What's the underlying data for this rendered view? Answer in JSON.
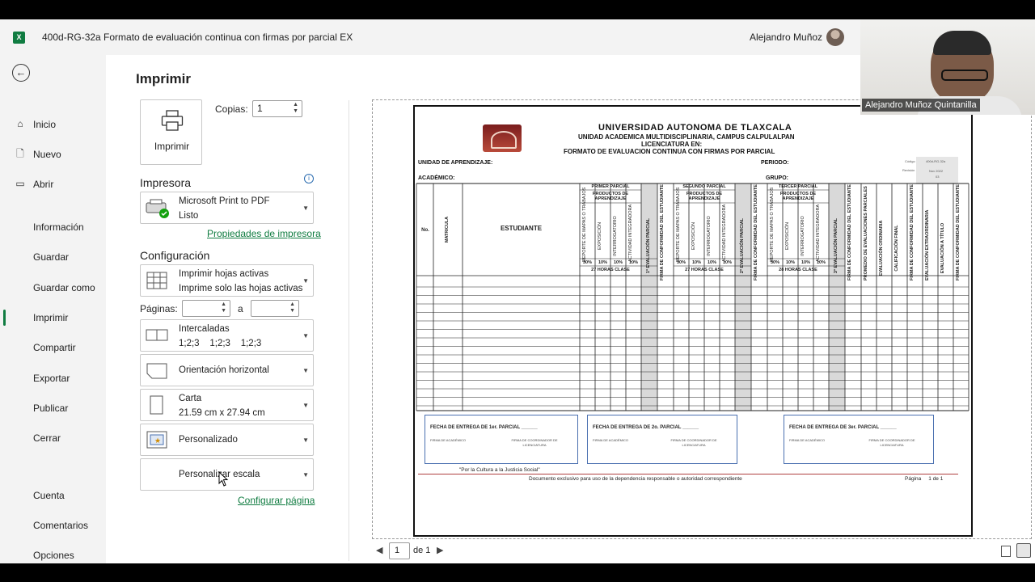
{
  "titlebar": {
    "app_icon": "excel-icon",
    "doc_title": "400d-RG-32a Formato de evaluación continua con firmas por parcial EX",
    "user_name": "Alejandro Muñoz"
  },
  "nav": {
    "items": [
      {
        "label": "Inicio",
        "icon": "home-icon"
      },
      {
        "label": "Nuevo",
        "icon": "new-file-icon"
      },
      {
        "label": "Abrir",
        "icon": "folder-icon"
      },
      {
        "label": "Información"
      },
      {
        "label": "Guardar"
      },
      {
        "label": "Guardar como"
      },
      {
        "label": "Imprimir"
      },
      {
        "label": "Compartir"
      },
      {
        "label": "Exportar"
      },
      {
        "label": "Publicar"
      },
      {
        "label": "Cerrar"
      },
      {
        "label": "Cuenta"
      },
      {
        "label": "Comentarios"
      },
      {
        "label": "Opciones"
      }
    ]
  },
  "print": {
    "title": "Imprimir",
    "button_label": "Imprimir",
    "copies_label": "Copias:",
    "copies_value": "1",
    "printer_heading": "Impresora",
    "printer_name": "Microsoft Print to PDF",
    "printer_status": "Listo",
    "printer_props_link": "Propiedades de impresora",
    "config_heading": "Configuración",
    "scope_main": "Imprimir hojas activas",
    "scope_sub": "Imprime solo las hojas activas",
    "pages_label": "Páginas:",
    "pages_sep": "a",
    "collate_main": "Intercaladas",
    "collate_sub": "1;2;3    1;2;3    1;2;3",
    "orientation": "Orientación horizontal",
    "paper_main": "Carta",
    "paper_sub": "21.59 cm x 27.94 cm",
    "margins": "Personalizado",
    "scaling": "Personalizar escala",
    "page_setup_link": "Configurar página"
  },
  "preview": {
    "university": "UNIVERSIDAD AUTONOMA DE TLAXCALA",
    "unit": "UNIDAD ACADEMICA MULTIDISCIPLINARIA, CAMPUS CALPULALPAN",
    "degree": "LICENCIATURA EN:",
    "form_title": "FORMATO DE EVALUACION CONTINUA CON FIRMAS POR PARCIAL",
    "field_unit": "UNIDAD DE APRENDIZAJE:",
    "field_period": "PERIODO:",
    "field_academic": "ACADÉMICO:",
    "field_group": "GRUPO:",
    "code_label": "Código",
    "code_value": "400d-RG-32a",
    "rev_label": "Revisión",
    "rev_value": "Nov 2022",
    "rev_num": "03",
    "col_no": "No.",
    "col_matricula": "MATRICULA",
    "col_student": "ESTUDIANTE",
    "partials": [
      {
        "name": "PRIMER PARCIAL",
        "hours": "27 HORAS CLASE"
      },
      {
        "name": "SEGUNDO PARCIAL",
        "hours": "27 HORAS CLASE"
      },
      {
        "name": "TERCER PARCIAL",
        "hours": "28 HORAS CLASE"
      }
    ],
    "products_label": "PRODUCTOS DE APRENDIZAJE",
    "activities": [
      "REPORTE DE MAPAS O TRABAJOS",
      "EXPOSICIÓN",
      "INTERROGATORIO",
      "ACTIVIDAD INTEGRADORA"
    ],
    "pct": "30%",
    "pct_low": "10%",
    "partial_eval": [
      "1ª EVALUACIÓN PARCIAL",
      "2ª EVALUACIÓN PARCIAL",
      "3ª EVALUACIÓN PARCIAL"
    ],
    "signature_col": "FIRMA DE CONFORMIDAD DEL ESTUDIANTE",
    "final_cols": [
      "PROMEDIO DE EVALUACIONES PARCIALES",
      "EVALUACIÓN ORDINARIA",
      "CALIFICACIÓN FINAL",
      "FIRMA DE CONFORMIDAD DEL ESTUDIANTE",
      "EVALUACIÓN EXTRAORDINARIA",
      "EVALUACIÓN A TÍTULO",
      "FIRMA DE CONFORMIDAD DEL ESTUDIANTE"
    ],
    "sig_boxes": [
      {
        "title": "FECHA DE ENTREGA DE 1er. PARCIAL ______",
        "left": "FIRMA DE ACADÉMICO",
        "right": "FIRMA DE COORDINADOR DE LICENCIATURA"
      },
      {
        "title": "FECHA DE ENTREGA DE 2o. PARCIAL ______",
        "left": "FIRMA DE ACADÉMICO",
        "right": "FIRMA DE COORDINADOR DE LICENCIATURA"
      },
      {
        "title": "FECHA DE ENTREGA DE 3er. PARCIAL ______",
        "left": "FIRMA DE ACADÉMICO",
        "right": "FIRMA DE COORDINADOR DE LICENCIATURA"
      }
    ],
    "motto": "\"Por la Cultura a la Justicia Social\"",
    "footer_note": "Documento exclusivo para uso de la dependencia responsable o autoridad correspondiente",
    "footer_page": "Página     1 de 1"
  },
  "page_nav": {
    "current": "1",
    "of_label": "de 1"
  },
  "webcam": {
    "caption": "Alejandro Muñoz Quintanilla"
  },
  "colors": {
    "accent": "#107c41",
    "link": "#107c41",
    "sig_border": "#4a70b0"
  }
}
